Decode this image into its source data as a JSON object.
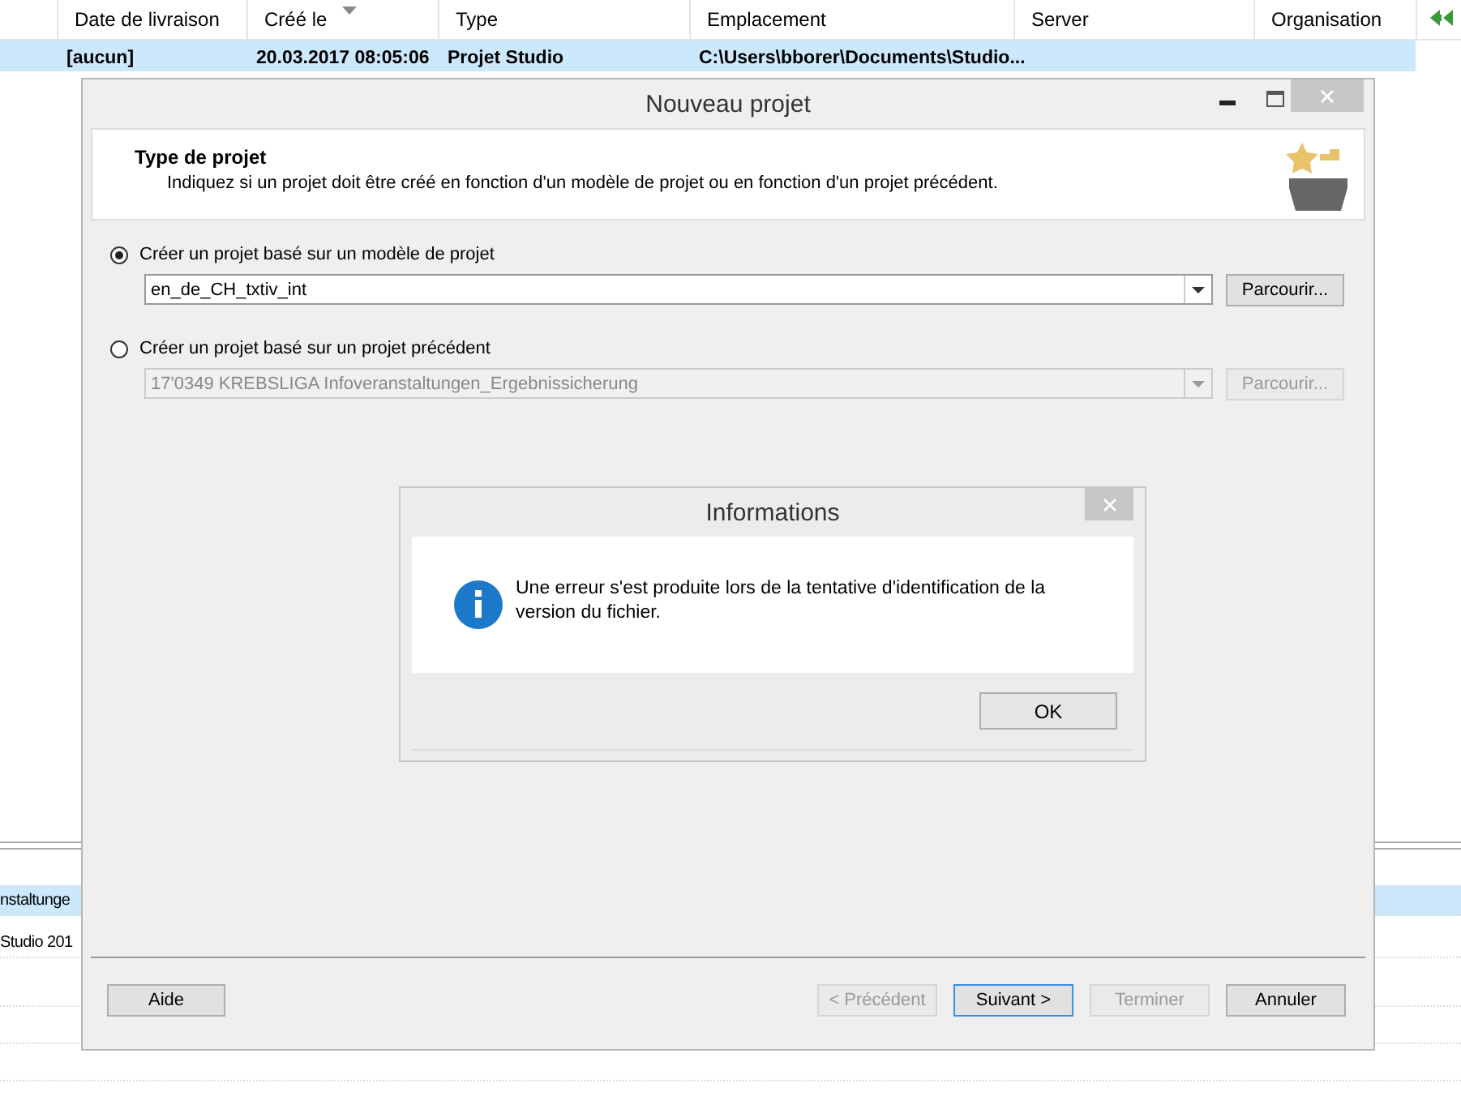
{
  "background_table": {
    "columns": [
      {
        "label": "Date de livraison",
        "sorted": false
      },
      {
        "label": "Créé le",
        "sorted": true
      },
      {
        "label": "Type",
        "sorted": false
      },
      {
        "label": "Emplacement",
        "sorted": false
      },
      {
        "label": "Server",
        "sorted": false
      },
      {
        "label": "Organisation",
        "sorted": false
      }
    ],
    "rows": [
      {
        "selected": true,
        "cells": [
          "[aucun]",
          "20.03.2017 08:05:06",
          "Projet Studio",
          "C:\\Users\\bborer\\Documents\\Studio..."
        ]
      }
    ]
  },
  "background_list": {
    "rows": [
      {
        "text": "nstaltunge",
        "selected": true
      },
      {
        "text": "Studio 201",
        "selected": false
      }
    ]
  },
  "wizard": {
    "title": "Nouveau projet",
    "header": {
      "title": "Type de projet",
      "description": "Indiquez si un projet doit être créé en fonction d'un modèle de projet ou en fonction d'un projet précédent."
    },
    "options": [
      {
        "label": "Créer un projet basé sur un modèle de projet",
        "selected": true,
        "value": "en_de_CH_txtiv_int",
        "disabled": false,
        "browse": "Parcourir..."
      },
      {
        "label": "Créer un projet basé sur un projet précédent",
        "selected": false,
        "value": "17'0349 KREBSLIGA Infoveranstaltungen_Ergebnissicherung",
        "disabled": true,
        "browse": "Parcourir..."
      }
    ],
    "left_buttons": [
      {
        "label": "Aide",
        "disabled": false,
        "focused": false
      }
    ],
    "right_buttons": [
      {
        "label": "< Précédent",
        "disabled": true,
        "focused": false
      },
      {
        "label": "Suivant >",
        "disabled": false,
        "focused": true
      },
      {
        "label": "Terminer",
        "disabled": true,
        "focused": false
      },
      {
        "label": "Annuler",
        "disabled": false,
        "focused": false
      }
    ]
  },
  "message_box": {
    "title": "Informations",
    "message": "Une erreur s'est produite lors de la tentative d'identification de la version du fichier.",
    "button": "OK"
  }
}
